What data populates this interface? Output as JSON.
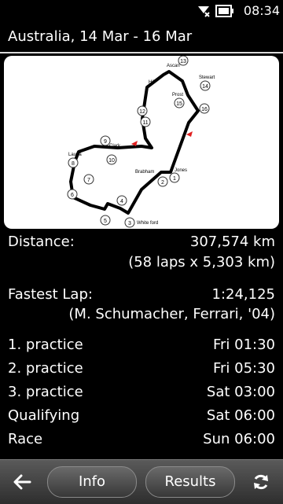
{
  "status": {
    "time": "08:34",
    "icons": [
      "no-sim-icon",
      "battery-icon"
    ]
  },
  "header": {
    "title": "Australia, 14 Mar - 16 Mar"
  },
  "track": {
    "corner_numbers": [
      "1",
      "2",
      "3",
      "4",
      "5",
      "6",
      "7",
      "8",
      "9",
      "10",
      "11",
      "12",
      "13",
      "14",
      "15",
      "16"
    ],
    "corner_names": {
      "ascari": "Ascari",
      "stewart": "Stewart",
      "hill": "Hill",
      "prost": "Prost",
      "clark": "Clark",
      "lauda": "Lauda",
      "brabham": "Brabham",
      "jones": "Jones",
      "whiteford": "White ford"
    }
  },
  "stats": {
    "distance_label": "Distance:",
    "distance_value": "307,574 km",
    "distance_detail": "(58 laps x 5,303 km)",
    "fastest_label": "Fastest Lap:",
    "fastest_value": "1:24,125",
    "fastest_detail": "(M. Schumacher, Ferrari, '04)"
  },
  "schedule": [
    {
      "session": "1. practice",
      "time": "Fri 01:30"
    },
    {
      "session": "2. practice",
      "time": "Fri 05:30"
    },
    {
      "session": "3. practice",
      "time": "Sat 03:00"
    },
    {
      "session": "Qualifying",
      "time": "Sat 06:00"
    },
    {
      "session": "Race",
      "time": "Sun 06:00"
    }
  ],
  "toolbar": {
    "back_icon": "back-arrow-icon",
    "info_label": "Info",
    "results_label": "Results",
    "refresh_icon": "refresh-icon"
  }
}
